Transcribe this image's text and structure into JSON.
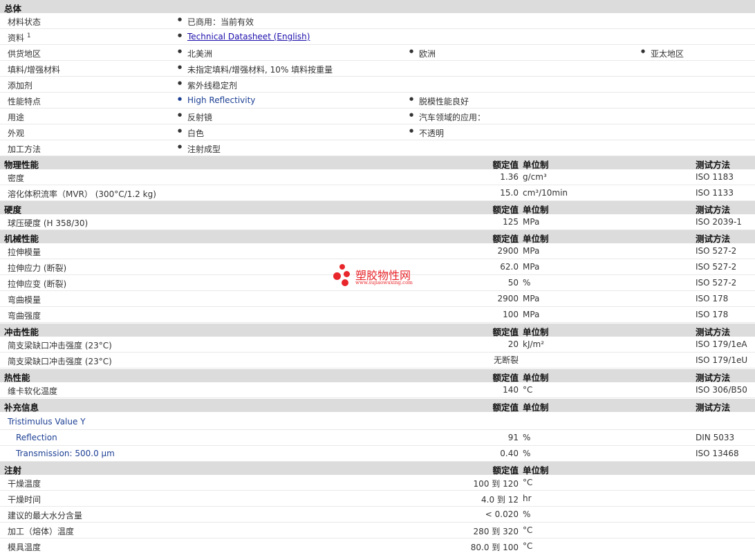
{
  "general": {
    "title": "总体",
    "status": {
      "label": "材料状态",
      "value": "已商用：当前有效"
    },
    "docs": {
      "label": "资料",
      "sup": "1",
      "link": "Technical Datasheet (English)"
    },
    "region": {
      "label": "供货地区",
      "v1": "北美洲",
      "v2": "欧洲",
      "v3": "亚太地区"
    },
    "filler": {
      "label": "填料/增强材料",
      "value": "未指定填料/增强材料, 10% 填料按重量"
    },
    "additive": {
      "label": "添加剂",
      "value": "紫外线稳定剂"
    },
    "features": {
      "label": "性能特点",
      "v1": "High Reflectivity",
      "v2": "脱模性能良好"
    },
    "uses": {
      "label": "用途",
      "v1": "反射镜",
      "v2": "汽车领域的应用："
    },
    "appearance": {
      "label": "外观",
      "v1": "白色",
      "v2": "不透明"
    },
    "processing": {
      "label": "加工方法",
      "value": "注射成型"
    }
  },
  "headers": {
    "rated": "额定值",
    "unit": "单位制",
    "method": "测试方法"
  },
  "physical": {
    "title": "物理性能",
    "rows": [
      {
        "label": "密度",
        "value": "1.36",
        "unit": "g/cm³",
        "method": "ISO 1183"
      },
      {
        "label": "溶化体积流率（MVR） (300°C/1.2 kg)",
        "value": "15.0",
        "unit": "cm³/10min",
        "method": "ISO 1133"
      }
    ]
  },
  "hardness": {
    "title": "硬度",
    "rows": [
      {
        "label": "球压硬度 (H 358/30)",
        "value": "125",
        "unit": "MPa",
        "method": "ISO 2039-1"
      }
    ]
  },
  "mechanical": {
    "title": "机械性能",
    "rows": [
      {
        "label": "拉伸模量",
        "value": "2900",
        "unit": "MPa",
        "method": "ISO 527-2"
      },
      {
        "label": "拉伸应力 (断裂)",
        "value": "62.0",
        "unit": "MPa",
        "method": "ISO 527-2"
      },
      {
        "label": "拉伸应变 (断裂)",
        "value": "50",
        "unit": "%",
        "method": "ISO 527-2"
      },
      {
        "label": "弯曲模量",
        "value": "2900",
        "unit": "MPa",
        "method": "ISO 178"
      },
      {
        "label": "弯曲强度",
        "value": "100",
        "unit": "MPa",
        "method": "ISO 178"
      }
    ]
  },
  "impact": {
    "title": "冲击性能",
    "rows": [
      {
        "label": "简支梁缺口冲击强度 (23°C)",
        "value": "20",
        "unit": "kJ/m²",
        "method": "ISO 179/1eA"
      },
      {
        "label": "简支梁缺口冲击强度 (23°C)",
        "value": "无断裂",
        "unit": "",
        "method": "ISO 179/1eU"
      }
    ]
  },
  "thermal": {
    "title": "热性能",
    "rows": [
      {
        "label": "维卡软化温度",
        "value": "140",
        "unit": "°C",
        "method": "ISO 306/B50"
      }
    ]
  },
  "supplement": {
    "title": "补充信息",
    "group": "Tristimulus Value Y",
    "rows": [
      {
        "label": "Reflection",
        "value": "91",
        "unit": "%",
        "method": "DIN 5033"
      },
      {
        "label": "Transmission: 500.0 µm",
        "value": "0.40",
        "unit": "%",
        "method": "ISO 13468"
      }
    ]
  },
  "injection": {
    "title": "注射",
    "rows": [
      {
        "label": "干燥温度",
        "value": "100 到 120",
        "unit": "°C"
      },
      {
        "label": "干燥时间",
        "value": "4.0 到 12",
        "unit": "hr"
      },
      {
        "label": "建议的最大水分含量",
        "value": "< 0.020",
        "unit": "%"
      },
      {
        "label": "加工（熔体）温度",
        "value": "280 到 320",
        "unit": "°C"
      },
      {
        "label": "模具温度",
        "value": "80.0 到 100",
        "unit": "°C"
      }
    ]
  },
  "watermark": {
    "cn": "塑胶物性网",
    "url": "www.sujiaowuxing.com",
    "brand_color": "#e8262b"
  }
}
